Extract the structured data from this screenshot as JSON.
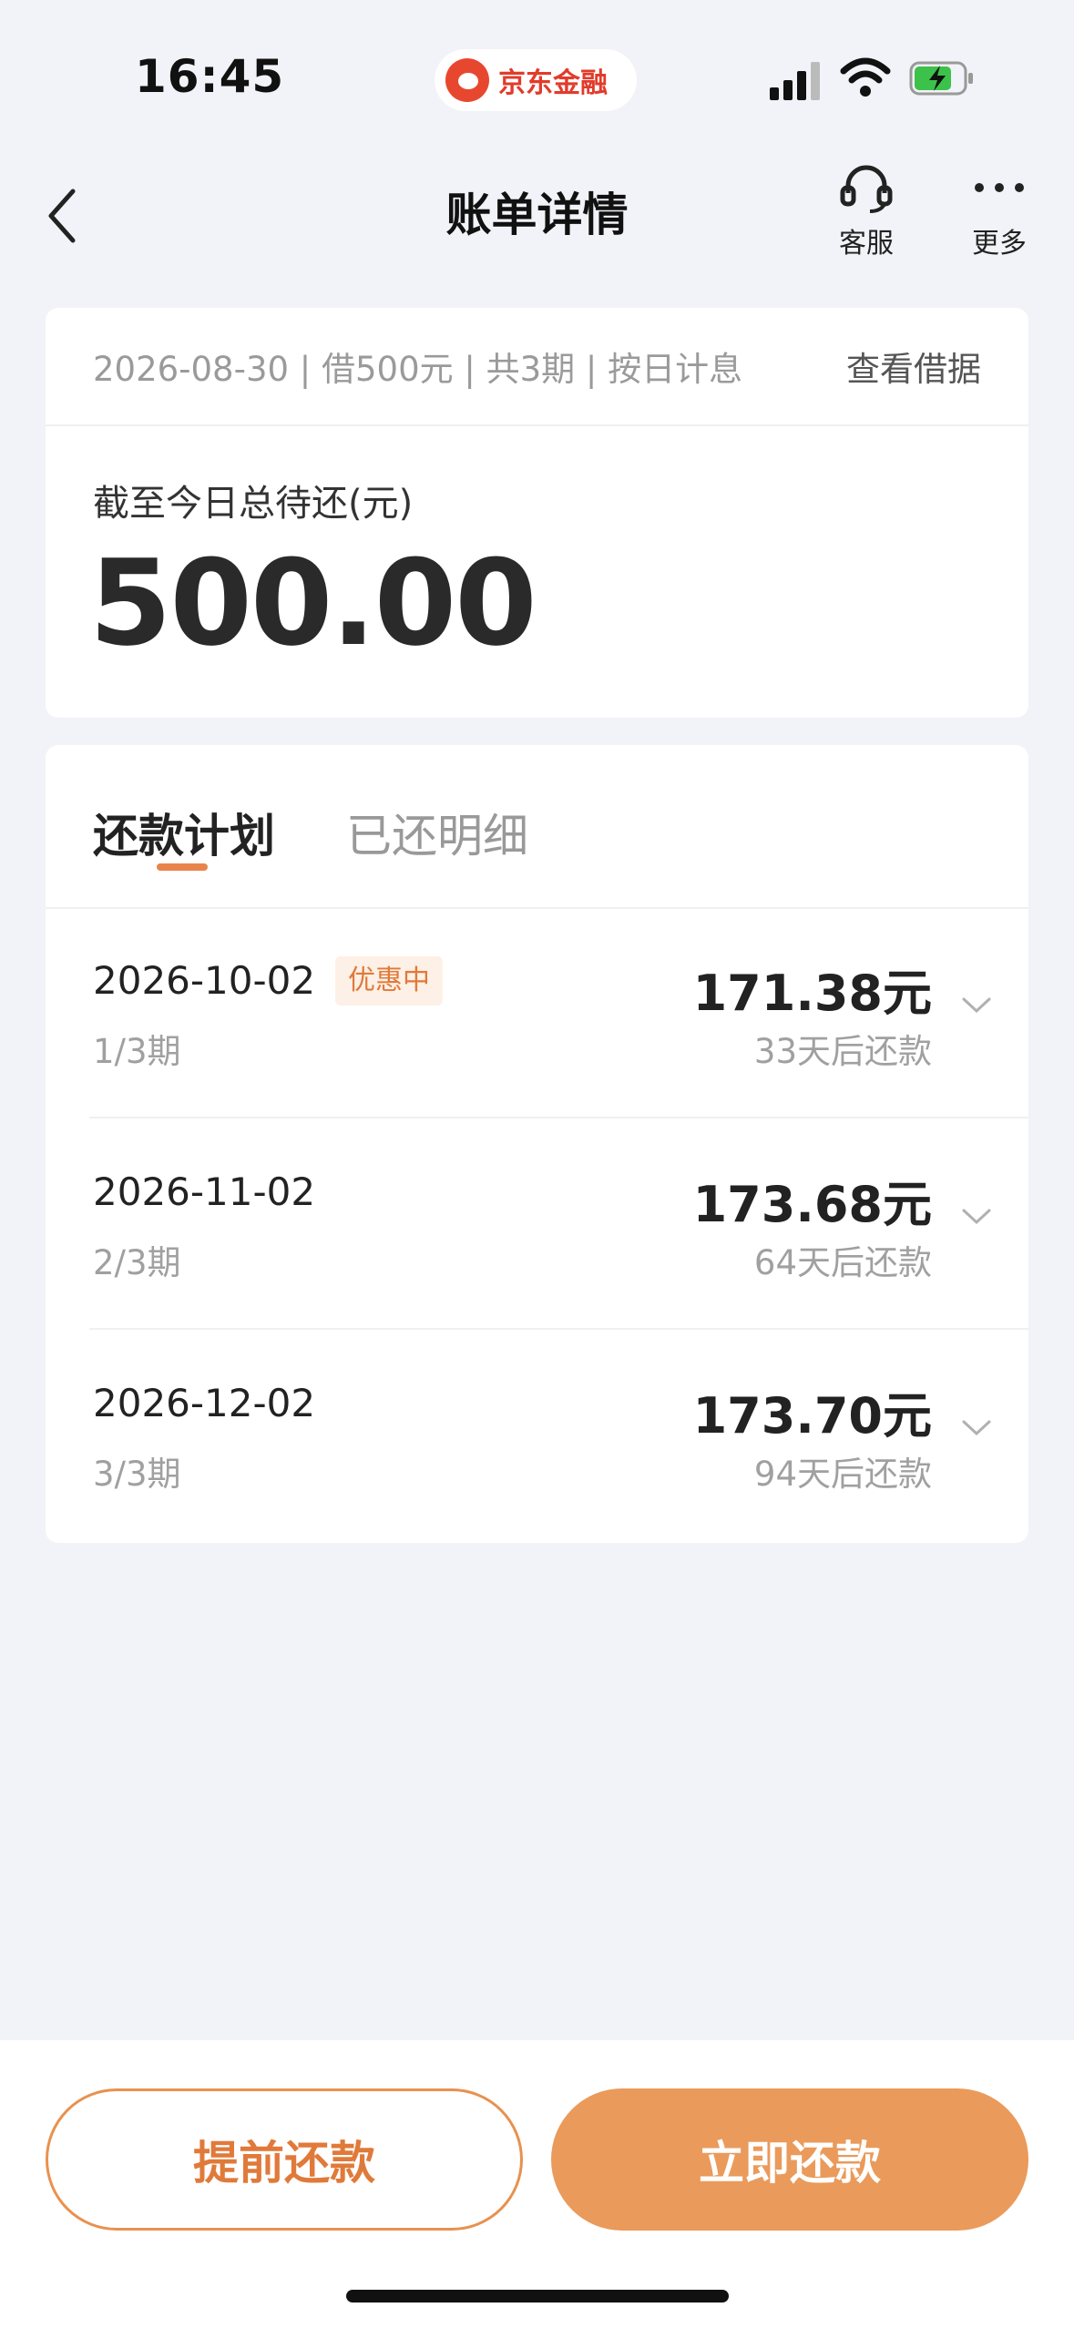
{
  "status_bar": {
    "time": "16:45",
    "app_name": "京东金融"
  },
  "nav": {
    "title": "账单详情",
    "service_label": "客服",
    "more_label": "更多"
  },
  "summary": {
    "meta": "2026-08-30 | 借500元 | 共3期 | 按日计息",
    "view_receipt": "查看借据",
    "total_label": "截至今日总待还(元)",
    "total_amount": "500.00"
  },
  "plan": {
    "tabs": [
      {
        "label": "还款计划",
        "active": true
      },
      {
        "label": "已还明细",
        "active": false
      }
    ],
    "installments": [
      {
        "date": "2026-10-02",
        "badge": "优惠中",
        "period": "1/3期",
        "amount": "171.38元",
        "due": "33天后还款"
      },
      {
        "date": "2026-11-02",
        "period": "2/3期",
        "amount": "173.68元",
        "due": "64天后还款"
      },
      {
        "date": "2026-12-02",
        "period": "3/3期",
        "amount": "173.70元",
        "due": "94天后还款"
      }
    ]
  },
  "actions": {
    "early_repay": "提前还款",
    "repay_now": "立即还款"
  },
  "colors": {
    "accent": "#e8914f",
    "accent_text": "#e07a3a",
    "background": "#f2f3f8"
  },
  "icons": [
    "back-arrow-icon",
    "headset-icon",
    "more-dots-icon",
    "chevron-down-icon",
    "signal-icon",
    "wifi-icon",
    "battery-charging-icon"
  ]
}
